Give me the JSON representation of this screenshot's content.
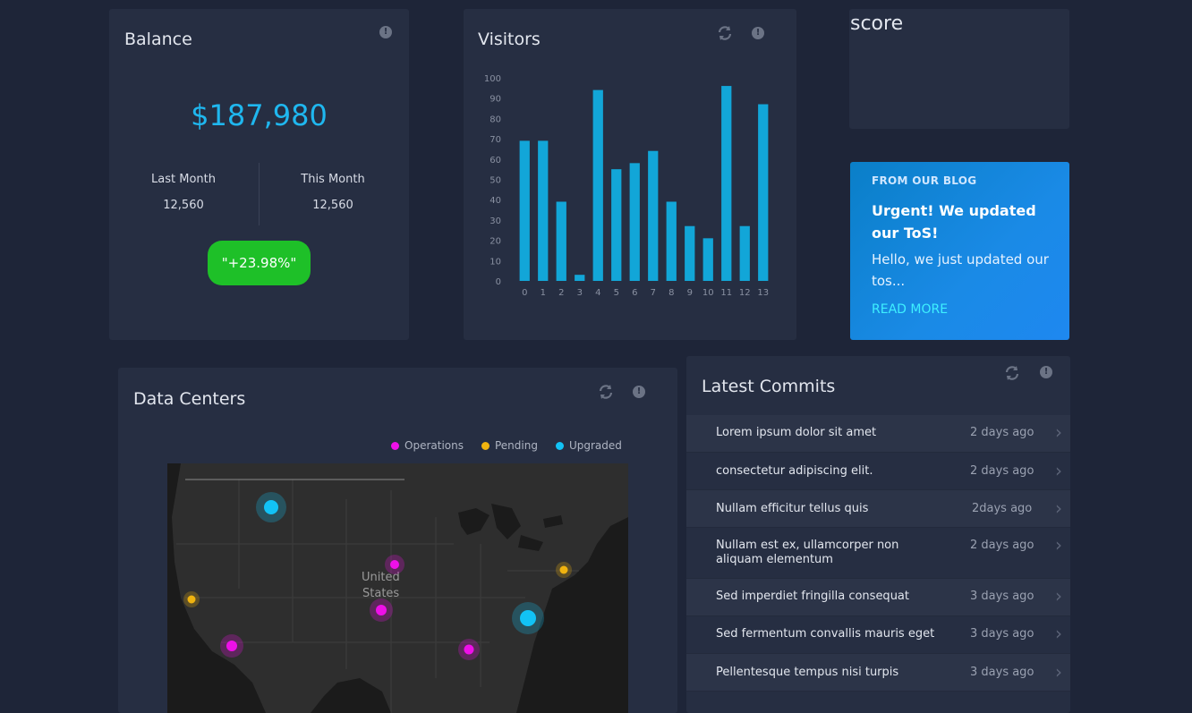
{
  "balance": {
    "title": "Balance",
    "amount": "$187,980",
    "last_month_label": "Last Month",
    "last_month_value": "12,560",
    "this_month_label": "This Month",
    "this_month_value": "12,560",
    "change": "\"+23.98%\""
  },
  "visitors": {
    "title": "Visitors",
    "chart_data": {
      "type": "bar",
      "title": "",
      "categories": [
        "0",
        "1",
        "2",
        "3",
        "4",
        "5",
        "6",
        "7",
        "8",
        "9",
        "10",
        "11",
        "12",
        "13"
      ],
      "values": [
        69,
        69,
        39,
        3,
        94,
        55,
        58,
        64,
        39,
        27,
        21,
        96,
        27,
        87
      ],
      "y_ticks": [
        "0",
        "10",
        "20",
        "30",
        "40",
        "50",
        "60",
        "70",
        "80",
        "90",
        "100"
      ],
      "ylim": [
        0,
        100
      ],
      "grid": false,
      "bar_color": "#12a6d8"
    }
  },
  "score": {
    "title": "score"
  },
  "blog": {
    "kicker": "FROM OUR BLOG",
    "headline": "Urgent! We updated our ToS!",
    "excerpt": "Hello, we just updated our tos...",
    "read_more": "READ MORE"
  },
  "data_centers": {
    "title": "Data Centers",
    "legend": [
      {
        "label": "Operations",
        "color": "#ee10e8"
      },
      {
        "label": "Pending",
        "color": "#f0b30f"
      },
      {
        "label": "Upgraded",
        "color": "#12c2f5"
      }
    ],
    "map_label_1": "United",
    "map_label_2": "States"
  },
  "commits": {
    "title": "Latest Commits",
    "items": [
      {
        "message": "Lorem ipsum dolor sit amet",
        "time": "2 days ago"
      },
      {
        "message": "consectetur adipiscing elit.",
        "time": "2 days ago"
      },
      {
        "message": "Nullam efficitur tellus quis",
        "time": "2days ago"
      },
      {
        "message": "Nullam est ex, ullamcorper non aliquam elementum",
        "time": "2 days ago"
      },
      {
        "message": "Sed imperdiet fringilla consequat",
        "time": "3 days ago"
      },
      {
        "message": "Sed fermentum convallis mauris eget",
        "time": "3 days ago"
      },
      {
        "message": "Pellentesque tempus nisi turpis",
        "time": "3 days ago"
      }
    ]
  }
}
